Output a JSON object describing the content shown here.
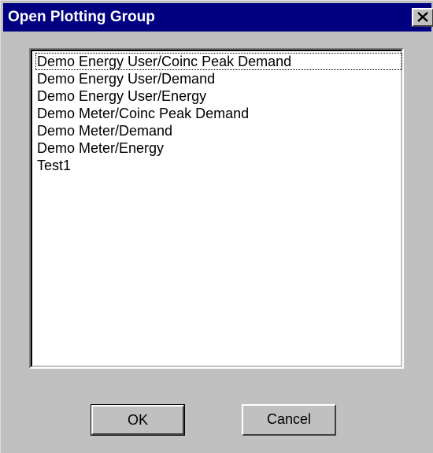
{
  "window": {
    "title": "Open Plotting Group",
    "close_icon": "close-x-icon"
  },
  "list": {
    "items": [
      "Demo Energy User/Coinc Peak Demand",
      "Demo Energy User/Demand",
      "Demo Energy User/Energy",
      "Demo Meter/Coinc Peak Demand",
      "Demo Meter/Demand",
      "Demo Meter/Energy",
      "Test1"
    ],
    "focused_index": 0
  },
  "buttons": {
    "ok_label": "OK",
    "cancel_label": "Cancel"
  },
  "colors": {
    "titlebar": "#000080",
    "face": "#c0c0c0",
    "list_bg": "#ffffff"
  }
}
